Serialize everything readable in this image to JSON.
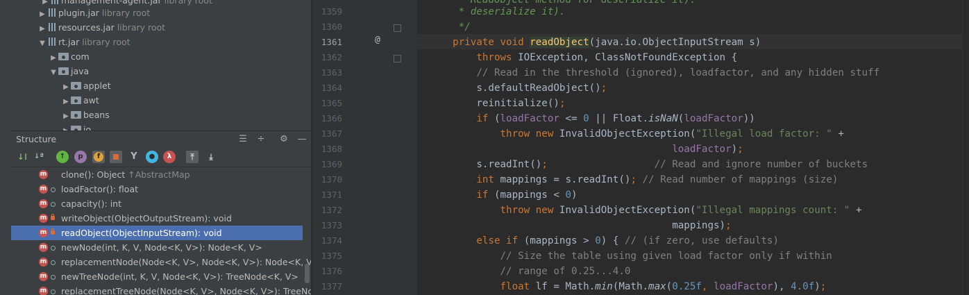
{
  "project_tree": {
    "rows": [
      {
        "name": "management-agent.jar",
        "suffix": "library root"
      },
      {
        "name": "plugin.jar",
        "suffix": "library root"
      },
      {
        "name": "resources.jar",
        "suffix": "library root"
      },
      {
        "name": "rt.jar",
        "suffix": "library root"
      },
      {
        "name": "com",
        "suffix": ""
      },
      {
        "name": "java",
        "suffix": ""
      },
      {
        "name": "applet",
        "suffix": ""
      },
      {
        "name": "awt",
        "suffix": ""
      },
      {
        "name": "beans",
        "suffix": ""
      },
      {
        "name": "io",
        "suffix": ""
      }
    ]
  },
  "structure": {
    "title": "Structure",
    "toolbar_icons": [
      "sort-by-visibility-icon",
      "sort-alphabetically-icon",
      "show-inherited-icon",
      "show-properties-icon",
      "show-fields-icon",
      "show-non-public-icon",
      "show-anonymous-icon",
      "show-lambdas-icon",
      "autoscroll-to-source-icon",
      "autoscroll-from-source-icon"
    ],
    "items": [
      {
        "label": "clone(): Object",
        "extra": "↑AbstractMap"
      },
      {
        "label": "loadFactor(): float",
        "extra": ""
      },
      {
        "label": "capacity(): int",
        "extra": ""
      },
      {
        "label": "writeObject(ObjectOutputStream): void",
        "extra": ""
      },
      {
        "label": "readObject(ObjectInputStream): void",
        "extra": ""
      },
      {
        "label": "newNode(int, K, V, Node<K, V>): Node<K, V>",
        "extra": ""
      },
      {
        "label": "replacementNode(Node<K, V>, Node<K, V>): Node<K, V>",
        "extra": ""
      },
      {
        "label": "newTreeNode(int, K, V, Node<K, V>): TreeNode<K, V>",
        "extra": ""
      },
      {
        "label": "replacementTreeNode(Node<K, V>, Node<K, V>): TreeNode",
        "extra": ""
      }
    ]
  },
  "editor": {
    "line_numbers": [
      "",
      "1359",
      "1360",
      "1361",
      "1362",
      "1363",
      "1364",
      "1365",
      "1366",
      "1367",
      "1368",
      "1369",
      "1370",
      "1371",
      "1372",
      "1373",
      "1374",
      "1375",
      "1376",
      "1377"
    ],
    "annotation_mark": "@",
    "code": {
      "l0": "     * ReadObject method for deserialize it). ",
      "l1359": "     * deserialize it).",
      "l1360": "     */",
      "l1361_kw": "private void ",
      "l1361_method": "readObject",
      "l1361_rest": "(java.io.ObjectInputStream s)",
      "l1362_kw": "throws ",
      "l1362_rest": "IOException, ClassNotFoundException {",
      "l1363": "// Read in the threshold (ignored), loadfactor, and any hidden stuff",
      "l1364_a": "s.defaultReadObject()",
      "l1365_a": "reinitialize()",
      "l1366_if": "if ",
      "l1366_a": "(",
      "l1366_f1": "loadFactor",
      "l1366_b": " <= ",
      "l1366_n": "0",
      "l1366_c": " || Float.",
      "l1366_m": "isNaN",
      "l1366_d": "(",
      "l1366_f2": "loadFactor",
      "l1366_e": "))",
      "l1367_kw": "throw new ",
      "l1367_a": "InvalidObjectException(",
      "l1367_s": "\"Illegal load factor: \"",
      "l1367_b": " +",
      "l1368_f": "loadFactor",
      "l1368_b": ")",
      "l1369_a": "s.readInt()",
      "l1369_c": "// Read and ignore number of buckets",
      "l1370_kw": "int ",
      "l1370_a": "mappings = s.readInt()",
      "l1370_c": "// Read number of mappings (size)",
      "l1371_if": "if ",
      "l1371_a": "(mappings < ",
      "l1371_n": "0",
      "l1371_b": ")",
      "l1372_kw": "throw new ",
      "l1372_a": "InvalidObjectException(",
      "l1372_s": "\"Illegal mappings count: \"",
      "l1372_b": " +",
      "l1373_a": "mappings)",
      "l1374_kw": "else if ",
      "l1374_a": "(mappings > ",
      "l1374_n": "0",
      "l1374_b": ") { ",
      "l1374_c": "// (if zero, use defaults)",
      "l1375": "// Size the table using given load factor only if within",
      "l1376": "// range of 0.25...4.0",
      "l1377_kw": "float ",
      "l1377_a": "lf = Math.",
      "l1377_m1": "min",
      "l1377_b": "(Math.",
      "l1377_m2": "max",
      "l1377_c": "(",
      "l1377_n1": "0.25f",
      "l1377_d": ", ",
      "l1377_f": "loadFactor",
      "l1377_e": "), ",
      "l1377_n2": "4.0f",
      "l1377_g": ")"
    }
  }
}
